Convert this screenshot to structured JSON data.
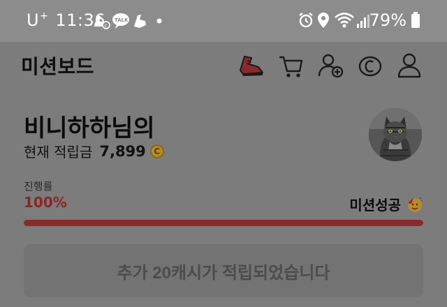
{
  "status_bar": {
    "carrier": "U",
    "carrier_sup": "+",
    "time": "11:36",
    "battery": "79%",
    "left_icons": [
      "running-shoe-notification-icon",
      "kakaotalk-icon",
      "running-shoe-notification-icon",
      "dot-icon"
    ],
    "right_icons": [
      "alarm-icon",
      "location-icon",
      "wifi-icon",
      "signal-icon",
      "battery-icon"
    ]
  },
  "header": {
    "title": "미션보드",
    "icons": [
      "shoe-icon",
      "cart-icon",
      "add-friend-icon",
      "cash-coin-icon",
      "profile-icon"
    ]
  },
  "user": {
    "greeting": "비니하하님의",
    "points_label": "현재 적립금",
    "points_value": "7,899",
    "coin_symbol": "C"
  },
  "progress": {
    "label": "진행률",
    "percent_text": "100%",
    "percent_value": 100,
    "status": "미션성공",
    "bar_color": "#8c2a2a"
  },
  "notice": {
    "text": "추가 20캐시가 적립되었습니다"
  }
}
